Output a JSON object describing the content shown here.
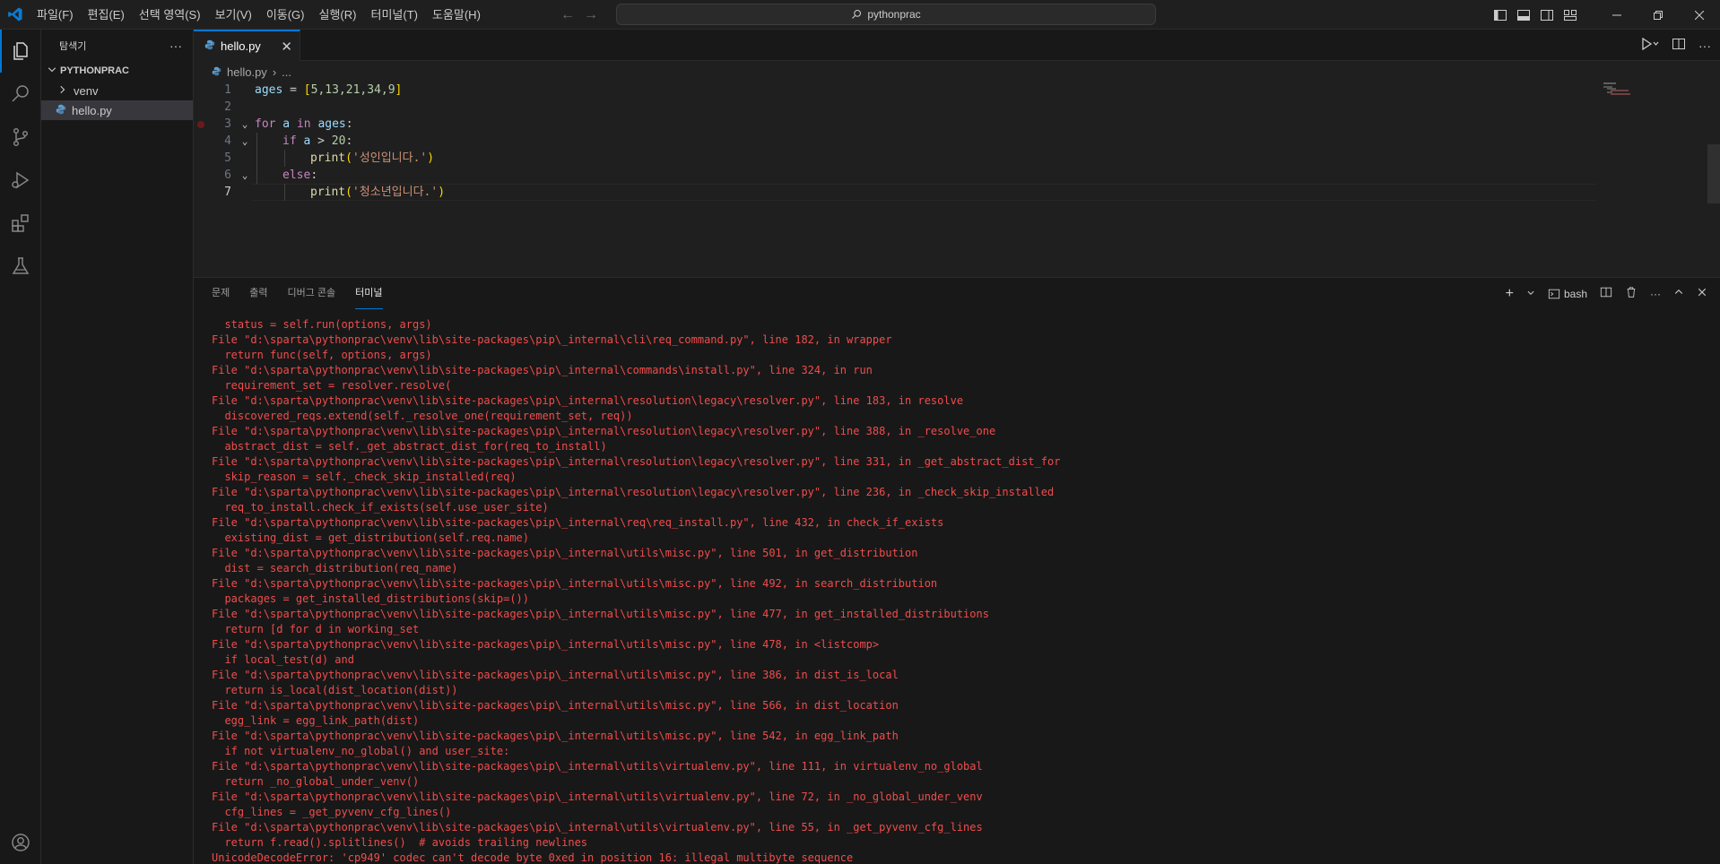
{
  "menu": [
    "파일(F)",
    "편집(E)",
    "선택 영역(S)",
    "보기(V)",
    "이동(G)",
    "실행(R)",
    "터미널(T)",
    "도움말(H)"
  ],
  "command_center": {
    "text": "pythonprac"
  },
  "sidebar": {
    "title": "탐색기",
    "more": "···",
    "section": "PYTHONPRAC",
    "items": [
      {
        "label": "venv",
        "type": "folder"
      },
      {
        "label": "hello.py",
        "type": "file"
      }
    ]
  },
  "tab": {
    "label": "hello.py",
    "close": "✕"
  },
  "breadcrumb": {
    "file": "hello.py",
    "rest": "..."
  },
  "editor": {
    "line_numbers": [
      "1",
      "2",
      "3",
      "4",
      "5",
      "6",
      "7"
    ]
  },
  "panel": {
    "tabs": [
      "문제",
      "출력",
      "디버그 콘솔",
      "터미널"
    ],
    "active_tab": "터미널",
    "shell": "bash",
    "terminal_lines": [
      "  status = self.run(options, args)",
      "File \"d:\\sparta\\pythonprac\\venv\\lib\\site-packages\\pip\\_internal\\cli\\req_command.py\", line 182, in wrapper",
      "  return func(self, options, args)",
      "File \"d:\\sparta\\pythonprac\\venv\\lib\\site-packages\\pip\\_internal\\commands\\install.py\", line 324, in run",
      "  requirement_set = resolver.resolve(",
      "File \"d:\\sparta\\pythonprac\\venv\\lib\\site-packages\\pip\\_internal\\resolution\\legacy\\resolver.py\", line 183, in resolve",
      "  discovered_reqs.extend(self._resolve_one(requirement_set, req))",
      "File \"d:\\sparta\\pythonprac\\venv\\lib\\site-packages\\pip\\_internal\\resolution\\legacy\\resolver.py\", line 388, in _resolve_one",
      "  abstract_dist = self._get_abstract_dist_for(req_to_install)",
      "File \"d:\\sparta\\pythonprac\\venv\\lib\\site-packages\\pip\\_internal\\resolution\\legacy\\resolver.py\", line 331, in _get_abstract_dist_for",
      "  skip_reason = self._check_skip_installed(req)",
      "File \"d:\\sparta\\pythonprac\\venv\\lib\\site-packages\\pip\\_internal\\resolution\\legacy\\resolver.py\", line 236, in _check_skip_installed",
      "  req_to_install.check_if_exists(self.use_user_site)",
      "File \"d:\\sparta\\pythonprac\\venv\\lib\\site-packages\\pip\\_internal\\req\\req_install.py\", line 432, in check_if_exists",
      "  existing_dist = get_distribution(self.req.name)",
      "File \"d:\\sparta\\pythonprac\\venv\\lib\\site-packages\\pip\\_internal\\utils\\misc.py\", line 501, in get_distribution",
      "  dist = search_distribution(req_name)",
      "File \"d:\\sparta\\pythonprac\\venv\\lib\\site-packages\\pip\\_internal\\utils\\misc.py\", line 492, in search_distribution",
      "  packages = get_installed_distributions(skip=())",
      "File \"d:\\sparta\\pythonprac\\venv\\lib\\site-packages\\pip\\_internal\\utils\\misc.py\", line 477, in get_installed_distributions",
      "  return [d for d in working_set",
      "File \"d:\\sparta\\pythonprac\\venv\\lib\\site-packages\\pip\\_internal\\utils\\misc.py\", line 478, in <listcomp>",
      "  if local_test(d) and",
      "File \"d:\\sparta\\pythonprac\\venv\\lib\\site-packages\\pip\\_internal\\utils\\misc.py\", line 386, in dist_is_local",
      "  return is_local(dist_location(dist))",
      "File \"d:\\sparta\\pythonprac\\venv\\lib\\site-packages\\pip\\_internal\\utils\\misc.py\", line 566, in dist_location",
      "  egg_link = egg_link_path(dist)",
      "File \"d:\\sparta\\pythonprac\\venv\\lib\\site-packages\\pip\\_internal\\utils\\misc.py\", line 542, in egg_link_path",
      "  if not virtualenv_no_global() and user_site:",
      "File \"d:\\sparta\\pythonprac\\venv\\lib\\site-packages\\pip\\_internal\\utils\\virtualenv.py\", line 111, in virtualenv_no_global",
      "  return _no_global_under_venv()",
      "File \"d:\\sparta\\pythonprac\\venv\\lib\\site-packages\\pip\\_internal\\utils\\virtualenv.py\", line 72, in _no_global_under_venv",
      "  cfg_lines = _get_pyvenv_cfg_lines()",
      "File \"d:\\sparta\\pythonprac\\venv\\lib\\site-packages\\pip\\_internal\\utils\\virtualenv.py\", line 55, in _get_pyvenv_cfg_lines",
      "  return f.read().splitlines()  # avoids trailing newlines",
      "UnicodeDecodeError: 'cp949' codec can't decode byte 0xed in position 16: illegal multibyte sequence"
    ]
  },
  "code": {
    "l1": {
      "var": "ages",
      "op": " = ",
      "open": "[",
      "nums": "5,13,21,34,9",
      "close": "]"
    },
    "l3": {
      "kw1": "for",
      "var1": " a ",
      "kw2": "in",
      "var2": " ages",
      "colon": ":"
    },
    "l4": {
      "kw": "if",
      "var": " a ",
      "op": "> ",
      "num": "20",
      "colon": ":"
    },
    "l5": {
      "fn": "print",
      "open": "(",
      "str": "'성인입니다.'",
      "close": ")"
    },
    "l6": {
      "kw": "else",
      "colon": ":"
    },
    "l7": {
      "fn": "print",
      "open": "(",
      "str": "'청소년입니다.'",
      "close": ")"
    }
  },
  "colors": {
    "accent": "#0078d4",
    "error_text": "#f14c4c",
    "breakpoint": "#6b1a1a"
  }
}
